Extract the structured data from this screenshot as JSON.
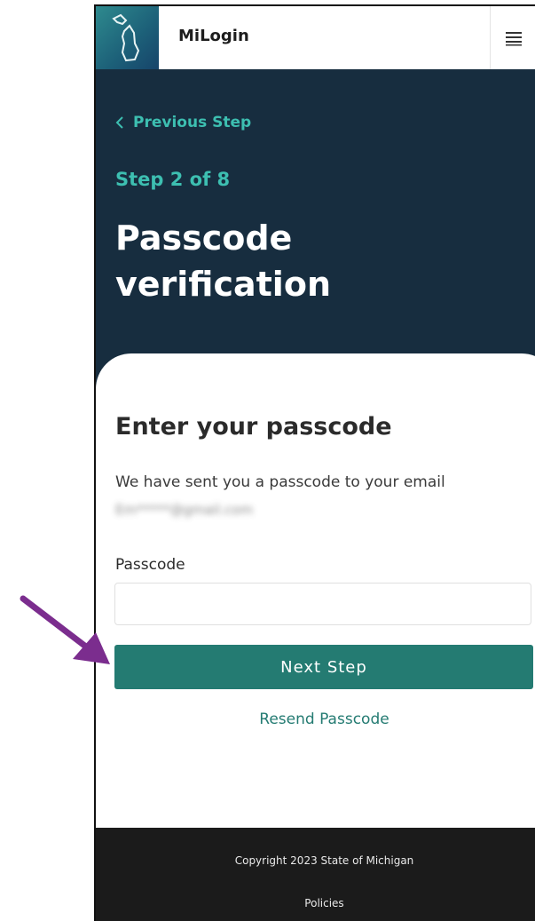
{
  "header": {
    "brand": "MiLogin",
    "logo_icon": "michigan-map-icon",
    "menu_icon": "hamburger-menu-icon"
  },
  "hero": {
    "previous_step": "Previous Step",
    "step": "Step 2 of 8",
    "title": "Passcode verification"
  },
  "card": {
    "title": "Enter your passcode",
    "message": "We have sent you a passcode to your email",
    "email_masked": "Em*****@gmail.com",
    "passcode_label": "Passcode",
    "passcode_value": "",
    "next_button": "Next Step",
    "resend_link": "Resend Passcode"
  },
  "footer": {
    "copyright": "Copyright 2023 State of Michigan",
    "policies": "Policies"
  },
  "colors": {
    "hero_bg": "#172d3f",
    "accent_teal": "#3dbfb1",
    "button_bg": "#247b72",
    "footer_bg": "#1b1b1b",
    "arrow": "#7b2d8e"
  }
}
